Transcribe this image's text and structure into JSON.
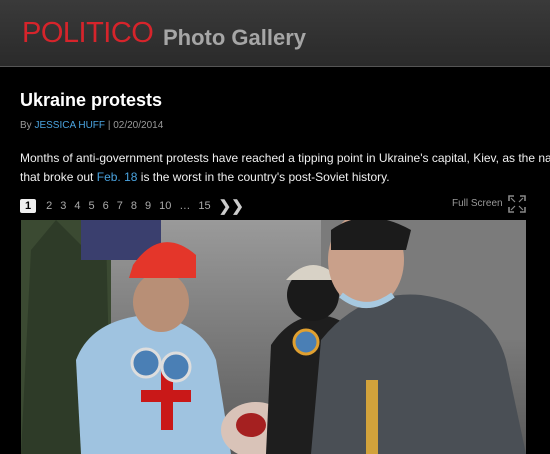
{
  "brand": {
    "logo": "POLITICO",
    "section": "Photo Gallery"
  },
  "article": {
    "title": "Ukraine protests",
    "by_prefix": "By",
    "author": "JESSICA HUFF",
    "separator": "|",
    "date": "02/20/2014",
    "desc_line1": "Months of anti-government protests have reached a tipping point in Ukraine's capital, Kiev, as the nation",
    "desc_line2_pre": "that broke out",
    "desc_link": "Feb. 18",
    "desc_line2_post": "is the worst in the country's post-Soviet history."
  },
  "pager": {
    "pages": [
      "1",
      "2",
      "3",
      "4",
      "5",
      "6",
      "7",
      "8",
      "9",
      "10",
      "…",
      "15"
    ],
    "active": "1",
    "next_icon": "chevron-right-icon"
  },
  "fullscreen": {
    "label": "Full Screen",
    "icon": "fullscreen-icon"
  },
  "photo": {
    "alt": "protesters carrying injured person"
  },
  "colors": {
    "brand_red": "#d6242b",
    "link_blue": "#4aa3df",
    "background": "#000000"
  }
}
